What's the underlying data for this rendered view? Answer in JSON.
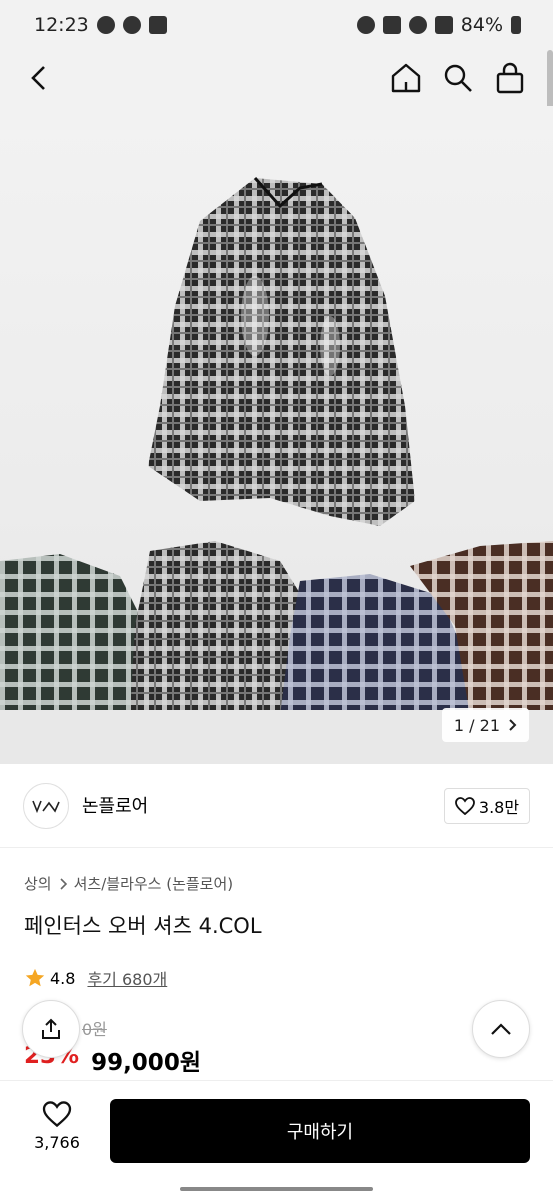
{
  "status_bar": {
    "time": "12:23",
    "battery": "84%"
  },
  "nav": {},
  "hero": {
    "pager_current": "1",
    "pager_sep": "/",
    "pager_total": "21"
  },
  "brand": {
    "name": "논플로어",
    "likes": "3.8만"
  },
  "product": {
    "breadcrumb": [
      "상의",
      "셔츠/블라우스 (논플로어)"
    ],
    "title": "페인터스 오버 셔츠 4.COL",
    "rating": "4.8",
    "review_label": "후기 680개",
    "original_price": "0원",
    "discount": "23%",
    "price": "99,000원"
  },
  "bottom": {
    "wish_count": "3,766",
    "buy_label": "구매하기"
  }
}
